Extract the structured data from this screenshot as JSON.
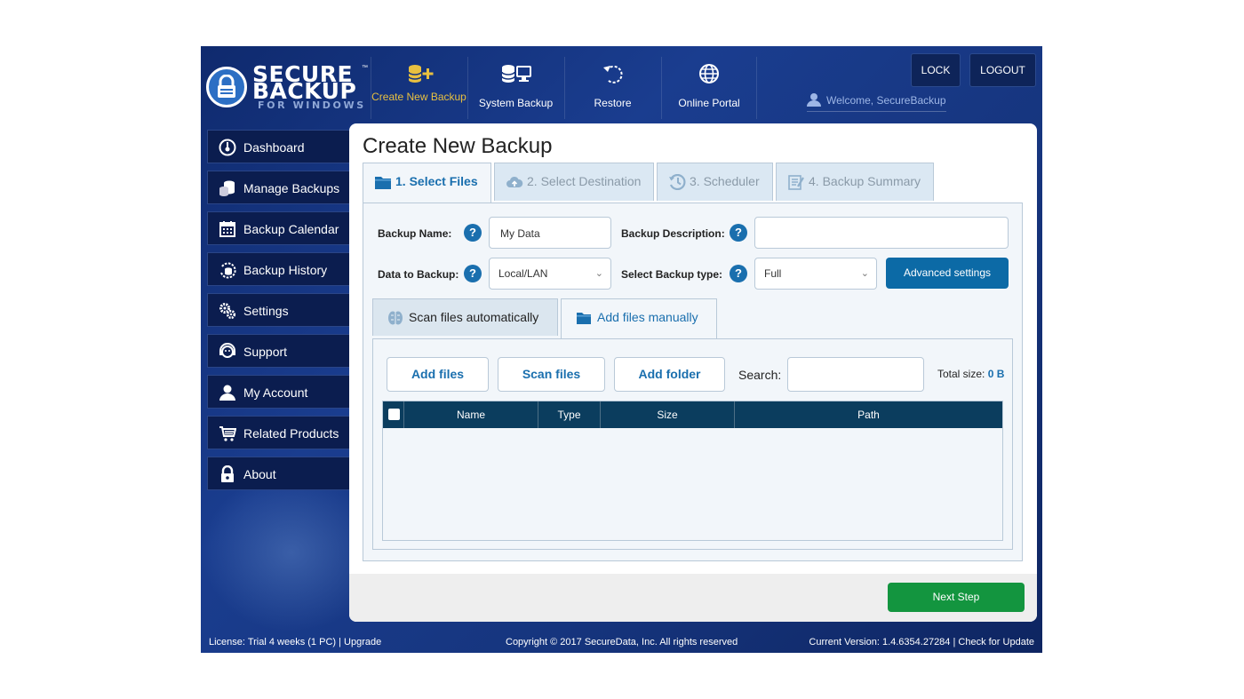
{
  "logo": {
    "line1": "SECURE",
    "tm": "™",
    "line2": "BACKUP",
    "line3": "FOR WINDOWS"
  },
  "topnav": [
    {
      "label": "Create New Backup",
      "icon": "create-backup-icon",
      "active": true
    },
    {
      "label": "System Backup",
      "icon": "system-backup-icon"
    },
    {
      "label": "Restore",
      "icon": "restore-icon"
    },
    {
      "label": "Online Portal",
      "icon": "globe-icon"
    }
  ],
  "header": {
    "lock": "LOCK",
    "logout": "LOGOUT",
    "welcome": "Welcome, SecureBackup"
  },
  "sidebar": {
    "items": [
      {
        "label": "Dashboard",
        "icon": "dashboard-icon"
      },
      {
        "label": "Manage Backups",
        "icon": "database-icon"
      },
      {
        "label": "Backup Calendar",
        "icon": "calendar-icon"
      },
      {
        "label": "Backup History",
        "icon": "history-icon"
      },
      {
        "label": "Settings",
        "icon": "gears-icon"
      },
      {
        "label": "Support",
        "icon": "headset-icon"
      },
      {
        "label": "My Account",
        "icon": "user-icon"
      },
      {
        "label": "Related Products",
        "icon": "cart-icon"
      },
      {
        "label": "About",
        "icon": "lock-icon"
      }
    ]
  },
  "main": {
    "title": "Create New Backup",
    "steps": [
      {
        "label": "1. Select Files",
        "icon": "folder-icon",
        "active": true
      },
      {
        "label": "2. Select Destination",
        "icon": "cloud-icon"
      },
      {
        "label": "3. Scheduler",
        "icon": "clock-icon"
      },
      {
        "label": "4. Backup Summary",
        "icon": "summary-icon"
      }
    ],
    "form": {
      "backup_name_label": "Backup Name:",
      "backup_name_value": "My Data",
      "backup_desc_label": "Backup Description:",
      "backup_desc_value": "",
      "data_label": "Data to Backup:",
      "data_value": "Local/LAN",
      "type_label": "Select Backup type:",
      "type_value": "Full",
      "help": "?",
      "advanced": "Advanced settings"
    },
    "subtabs": [
      {
        "label": "Scan files automatically",
        "icon": "brain-icon"
      },
      {
        "label": "Add files manually",
        "icon": "folder-icon",
        "active": true
      }
    ],
    "actions": {
      "add_files": "Add files",
      "scan_files": "Scan files",
      "add_folder": "Add folder",
      "search_label": "Search:",
      "search_value": "",
      "total_label": "Total size: ",
      "total_value": "0 B"
    },
    "table": {
      "columns": [
        "Name",
        "Type",
        "Size",
        "Path"
      ],
      "rows": []
    },
    "next": "Next Step"
  },
  "status": {
    "license": "License: Trial 4 weeks (1 PC) | Upgrade",
    "copyright": "Copyright © 2017 SecureData, Inc. All rights reserved",
    "version": "Current Version: 1.4.6354.27284 | Check for Update"
  },
  "colors": {
    "accent": "#1a6fae",
    "nav_bg": "#16357e",
    "next": "#13953f",
    "header_table": "#0b3d5e"
  }
}
